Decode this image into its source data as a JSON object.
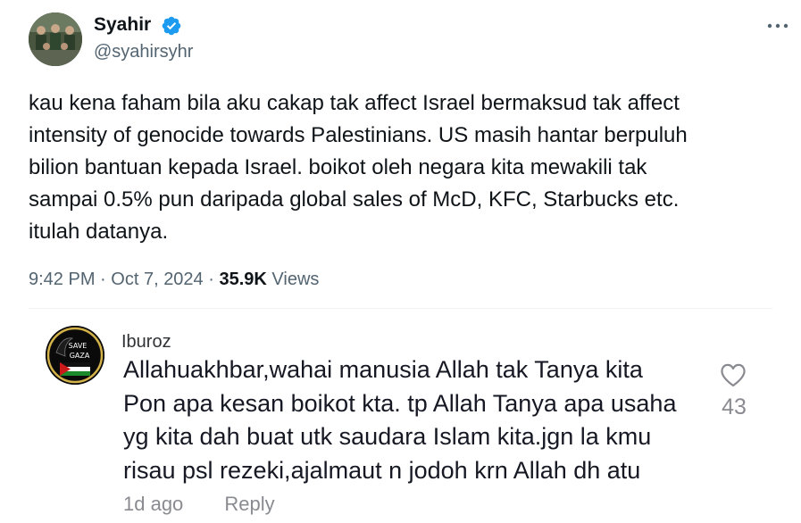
{
  "tweet": {
    "author": {
      "name": "Syahir",
      "handle": "@syahirsyhr",
      "verified": true
    },
    "text_lines": [
      "kau kena faham bila aku cakap tak affect Israel bermaksud tak affect",
      "intensity of genocide towards Palestinians. US masih hantar berpuluh",
      "bilion bantuan kepada Israel. boikot oleh negara kita mewakili tak",
      "sampai 0.5% pun daripada global sales of McD, KFC, Starbucks etc.",
      "itulah datanya."
    ],
    "time": "9:42 PM",
    "date": "Oct 7, 2024",
    "views_count": "35.9K",
    "views_label": "Views",
    "separator": "·",
    "more_icon": "more-horizontal-icon",
    "verified_color": "#1d9bf0"
  },
  "comment": {
    "username": "Iburoz",
    "avatar_text": [
      "SAVE",
      "GAZA"
    ],
    "text_lines": [
      "Allahuakhbar,wahai manusia Allah tak Tanya kita",
      "Pon apa kesan boikot kta. tp Allah Tanya apa usaha",
      "yg kita dah buat utk saudara Islam kita.jgn la kmu",
      "risau psl rezeki,ajalmaut n jodoh krn Allah dh atu"
    ],
    "likes": "43",
    "time": "1d ago",
    "reply_label": "Reply"
  }
}
